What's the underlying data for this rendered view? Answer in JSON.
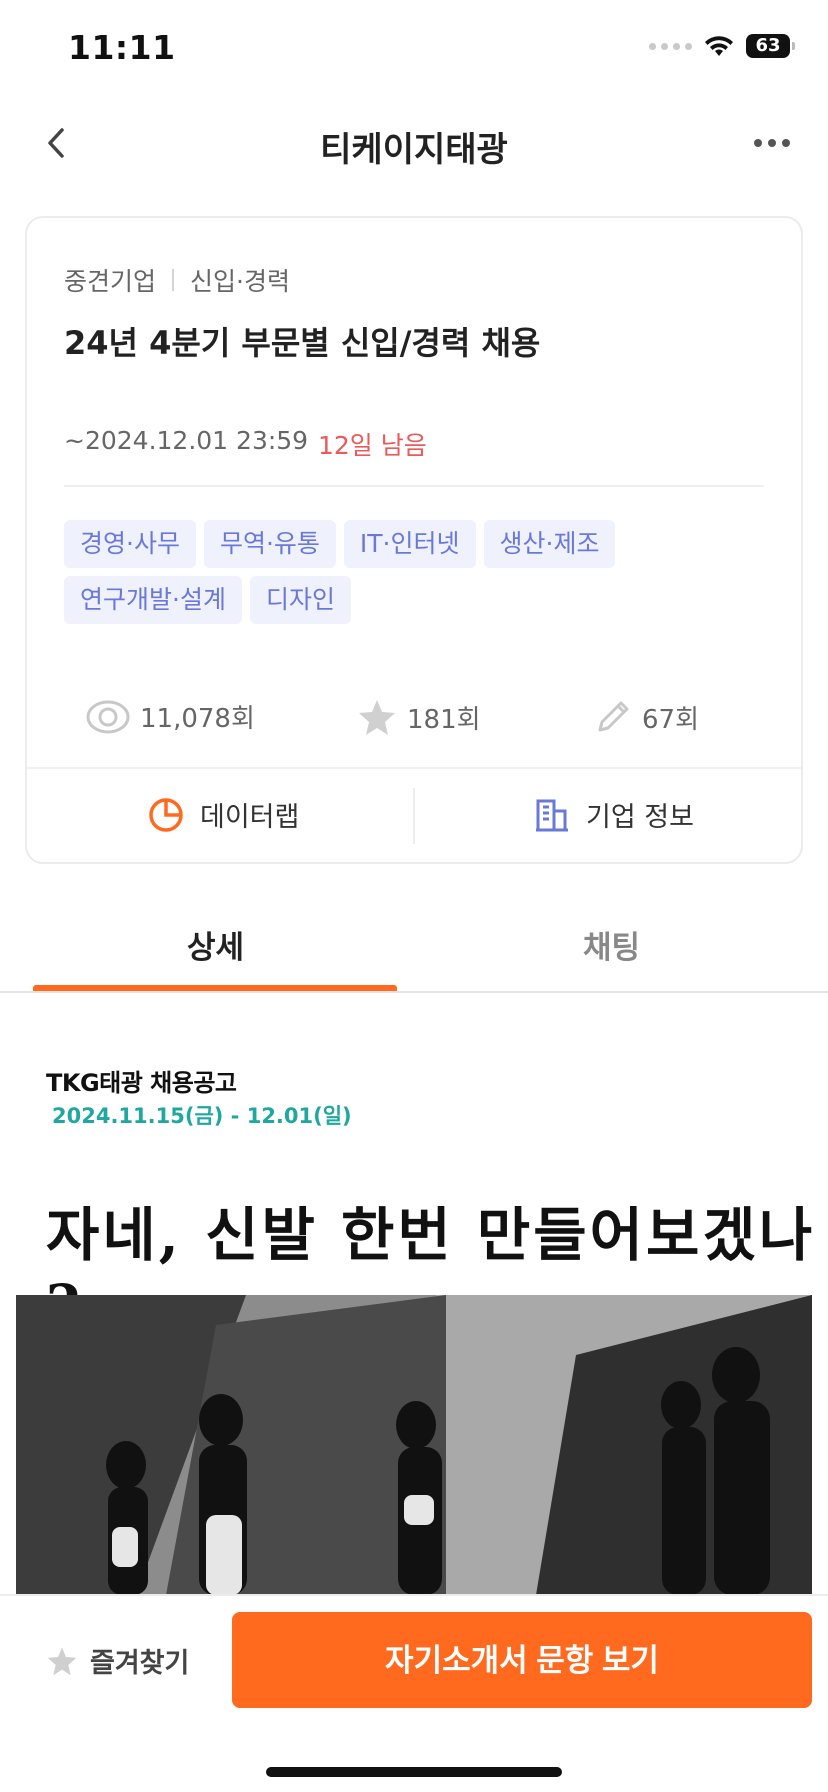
{
  "status_bar": {
    "time": "11:11",
    "battery": "63"
  },
  "nav": {
    "title": "티케이지태광"
  },
  "job": {
    "company_size": "중견기업",
    "hire_type": "신입·경력",
    "title": "24년 4분기 부문별 신입/경력 채용",
    "deadline": "~2024.12.01 23:59",
    "remaining": "12일 남음",
    "tags": [
      "경영·사무",
      "무역·유통",
      "IT·인터넷",
      "생산·제조",
      "연구개발·설계",
      "디자인"
    ]
  },
  "stats": {
    "views": "11,078회",
    "stars": "181회",
    "edits": "67회"
  },
  "actions": {
    "datalab": "데이터랩",
    "company_info": "기업 정보"
  },
  "tabs": {
    "detail": "상세",
    "chat": "채팅"
  },
  "poster": {
    "title": "TKG태광 채용공고",
    "date": "2024.11.15(금) - 12.01(일)",
    "headline": "자네, 신발 한번 만들어보겠나 ?"
  },
  "bottom": {
    "favorite": "즐겨찾기",
    "cta": "자기소개서 문항 보기"
  },
  "colors": {
    "accent": "#ff6a1e",
    "tag_text": "#6a79d8",
    "tag_bg": "#eff1fd",
    "remaining": "#ea5a5a",
    "poster_date": "#1fa7a0"
  }
}
